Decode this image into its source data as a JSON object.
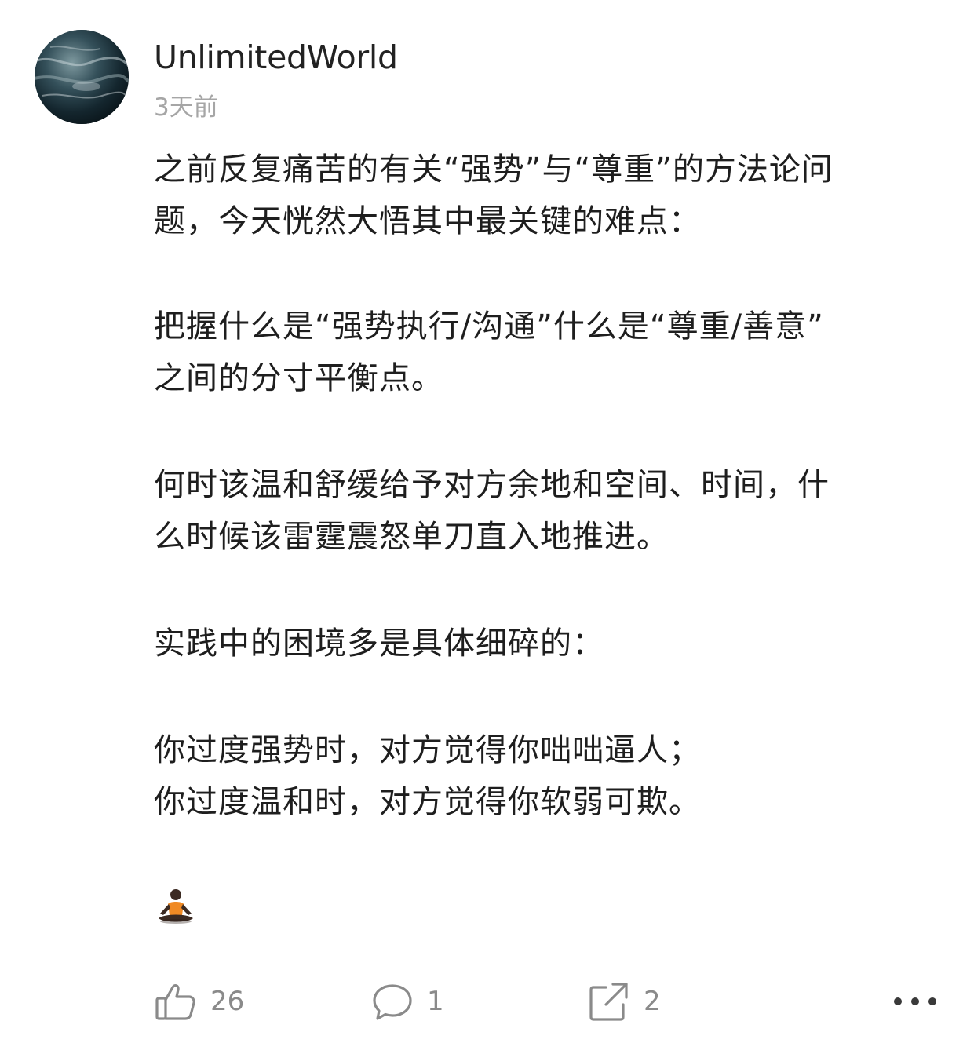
{
  "post": {
    "author": "UnlimitedWorld",
    "time": "3天前",
    "lines": [
      "之前反复痛苦的有关“强势”与“尊重”的方法论问",
      "题，今天恍然大悟其中最关键的难点：",
      "把握什么是“强势执行/沟通”什么是“尊重/善意”",
      "之间的分寸平衡点。",
      "何时该温和舒缓给予对方余地和空间、时间，什",
      "么时候该雷霆震怒单刀直入地推进。",
      "实践中的困境多是具体细碎的：",
      "你过度强势时，对方觉得你咄咄逼人；",
      "你过度温和时，对方觉得你软弱可欺。"
    ],
    "emoji": "🧘🏿"
  },
  "actions": {
    "like_count": "26",
    "comment_count": "1",
    "share_count": "2"
  },
  "icons": {
    "like": "thumbs-up-icon",
    "comment": "comment-bubble-icon",
    "share": "share-icon",
    "more": "more-dots-icon"
  },
  "colors": {
    "text": "#1e1e1e",
    "muted": "#a6a6a6",
    "icon": "#8a8a8a"
  }
}
